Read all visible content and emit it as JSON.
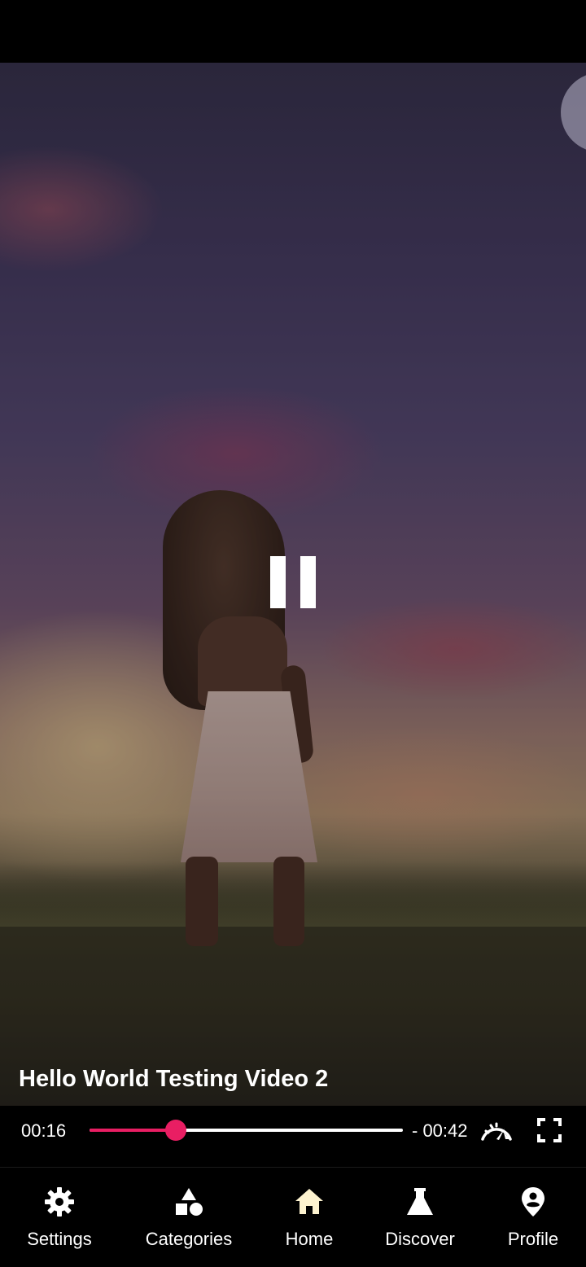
{
  "video": {
    "title": "Hello World Testing Video 2",
    "state": "playing",
    "control_icon": "pause-icon"
  },
  "player_controls": {
    "current_time": "00:16",
    "remaining_time": "- 00:42",
    "progress": 0.275,
    "speed_icon": "speed-gauge-icon",
    "fullscreen_icon": "fullscreen-icon",
    "accent_color": "#e91e63"
  },
  "bottom_nav": {
    "items": [
      {
        "label": "Settings",
        "icon": "gear-icon"
      },
      {
        "label": "Categories",
        "icon": "shapes-icon"
      },
      {
        "label": "Home",
        "icon": "home-icon",
        "active": true,
        "icon_color": "#fdf3cf"
      },
      {
        "label": "Discover",
        "icon": "flask-icon"
      },
      {
        "label": "Profile",
        "icon": "location-pin-icon"
      }
    ]
  }
}
